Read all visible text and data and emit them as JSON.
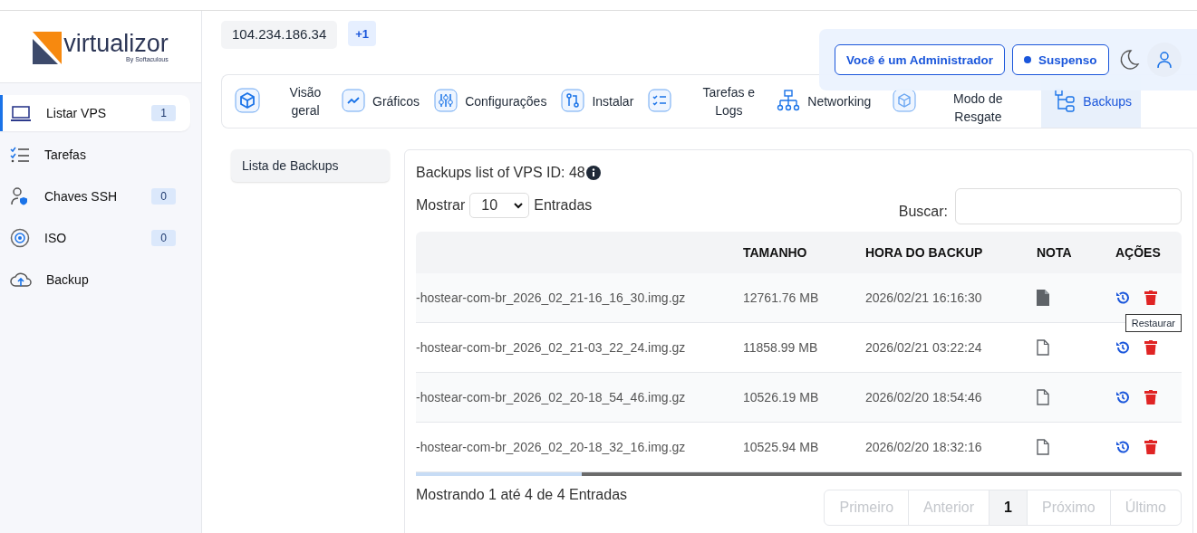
{
  "logo": {
    "name": "virtualizor",
    "tagline": "By Softaculous"
  },
  "sidebar": {
    "items": [
      {
        "label": "Listar VPS",
        "count": "1",
        "selected": true
      },
      {
        "label": "Tarefas",
        "selected": false
      },
      {
        "label": "Chaves SSH",
        "count": "0",
        "selected": false
      },
      {
        "label": "ISO",
        "count": "0",
        "selected": false
      },
      {
        "label": "Backup",
        "selected": false
      }
    ]
  },
  "header": {
    "ip": "104.234.186.34",
    "extra_ips": "+1",
    "admin_button": "Você é um Administrador",
    "status_button": "Suspenso"
  },
  "tabs": [
    {
      "label": "Visão geral",
      "selected": false
    },
    {
      "label": "Gráficos",
      "selected": false
    },
    {
      "label": "Configurações",
      "selected": false
    },
    {
      "label": "Instalar",
      "selected": false
    },
    {
      "label": "Tarefas e Logs",
      "selected": false
    },
    {
      "label": "Networking",
      "selected": false
    },
    {
      "label": "Modo de Resgate",
      "selected": false
    },
    {
      "label": "Backups",
      "selected": true
    }
  ],
  "subnav": {
    "items": [
      {
        "label": "Lista de Backups",
        "selected": true
      }
    ]
  },
  "backups": {
    "title": "Backups list of VPS ID: 48",
    "show_label": "Mostrar",
    "page_size": "10",
    "entries_label": "Entradas",
    "search_label": "Buscar:",
    "columns": [
      "TAMANHO",
      "HORA DO BACKUP",
      "NOTA",
      "AÇÕES"
    ],
    "rows": [
      {
        "file": "-hostear-com-br_2026_02_21-16_16_30.img.gz",
        "size": "12761.76 MB",
        "time": "2026/02/21 16:16:30",
        "has_note": true
      },
      {
        "file": "-hostear-com-br_2026_02_21-03_22_24.img.gz",
        "size": "11858.99 MB",
        "time": "2026/02/21 03:22:24",
        "has_note": false
      },
      {
        "file": "-hostear-com-br_2026_02_20-18_54_46.img.gz",
        "size": "10526.19 MB",
        "time": "2026/02/20 18:54:46",
        "has_note": false
      },
      {
        "file": "-hostear-com-br_2026_02_20-18_32_16.img.gz",
        "size": "10525.94 MB",
        "time": "2026/02/20 18:32:16",
        "has_note": false
      }
    ],
    "tooltip": "Restaurar",
    "summary": "Mostrando 1 até 4 de 4 Entradas",
    "pagination": [
      {
        "label": "Primeiro",
        "selected": false,
        "disabled": true
      },
      {
        "label": "Anterior",
        "selected": false,
        "disabled": true
      },
      {
        "label": "1",
        "selected": true,
        "disabled": false
      },
      {
        "label": "Próximo",
        "selected": false,
        "disabled": true
      },
      {
        "label": "Último",
        "selected": false,
        "disabled": true
      }
    ]
  }
}
